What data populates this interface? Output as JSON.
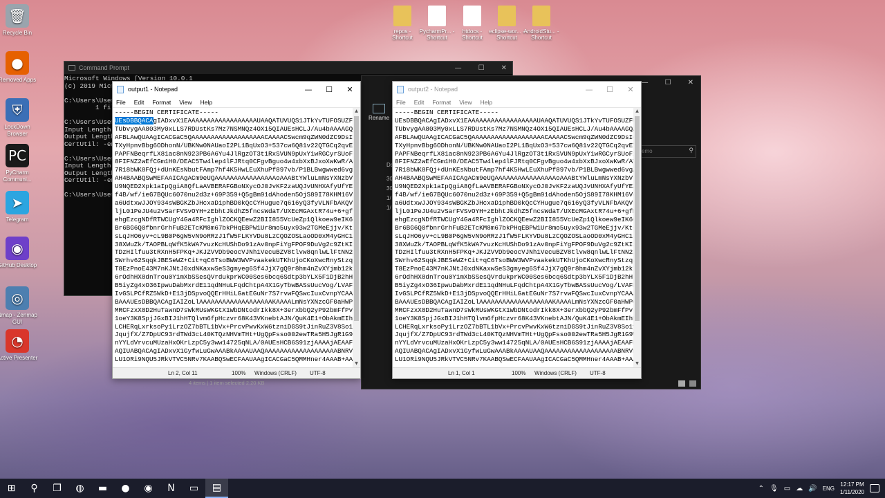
{
  "desktop_left_icons": [
    {
      "label": "Recycle Bin",
      "icon": "recycle-bin-icon",
      "glyph": "🗑",
      "color": "#9aa4ad"
    },
    {
      "label": "Removed Apps",
      "icon": "firefox-icon",
      "glyph": "●",
      "color": "#e66000"
    },
    {
      "label": "LockDown Browser",
      "icon": "lockdown-browser-icon",
      "glyph": "⛨",
      "color": "#3b6fb6"
    },
    {
      "label": "PyCharm Communi...",
      "icon": "pycharm-icon",
      "glyph": "PC",
      "color": "#1a1a1a"
    },
    {
      "label": "Telegram",
      "icon": "telegram-icon",
      "glyph": "➤",
      "color": "#2ca5e0"
    },
    {
      "label": "GitHub Desktop",
      "icon": "github-desktop-icon",
      "glyph": "◉",
      "color": "#6e40c9"
    },
    {
      "label": "Nmap - Zenmap GUI",
      "icon": "nmap-icon",
      "glyph": "◎",
      "color": "#4d7fb0"
    },
    {
      "label": "Active Presenter",
      "icon": "active-presenter-icon",
      "glyph": "◔",
      "color": "#d9362b"
    }
  ],
  "desktop_top_icons": [
    {
      "label": "repos - Shortcut",
      "icon": "folder-shortcut-icon",
      "color": "#e8c25a"
    },
    {
      "label": "PycharmPr... - Shortcut",
      "icon": "excel-shortcut-icon",
      "color": "#ffffff"
    },
    {
      "label": "htdocs - Shortcut",
      "icon": "file-shortcut-icon",
      "color": "#ffffff"
    },
    {
      "label": "eclipse-wor... - Shortcut",
      "icon": "folder-shortcut-icon",
      "color": "#e8c25a"
    },
    {
      "label": "AndroidStu... - Shortcut",
      "icon": "folder-shortcut-icon",
      "color": "#e8c25a"
    }
  ],
  "cmd": {
    "title": "Command Prompt",
    "lines": [
      "Microsoft Windows [Version 10.0.1",
      "(c) 2019 Micr",
      "",
      "C:\\Users\\User",
      "        1 fil",
      "",
      "C:\\Users\\User",
      "Input Length",
      "Output Length",
      "CertUtil: -en",
      "",
      "C:\\Users\\User",
      "Input Length",
      "Output Length",
      "CertUtil: -en",
      "",
      "C:\\Users\\User"
    ]
  },
  "explorer": {
    "rename_label": "Rename",
    "search_placeholder": "emo",
    "col_header": "Da",
    "col_values": [
      "30",
      "30",
      "1/",
      "1/"
    ],
    "status": "4 items  |  1 item selected  2.20 KB"
  },
  "notepad1": {
    "title": "output1 - Notepad",
    "menu": [
      "File",
      "Edit",
      "Format",
      "View",
      "Help"
    ],
    "selected_text": "UEsDBBQACA",
    "first_line_rest": "gIADxvX1EAAAAAAAAAAAAAAAAAAUAAQATUVUQS1JTkYvTUFOSUZFU1Qu",
    "status": {
      "pos": "Ln 2, Col 11",
      "zoom": "100%",
      "eol": "Windows (CRLF)",
      "enc": "UTF-8"
    }
  },
  "notepad2": {
    "title": "output2 - Notepad",
    "menu": [
      "File",
      "Edit",
      "Format",
      "View",
      "Help"
    ],
    "first_line": "UEsDBBQACAgIADxvX1EAAAAAAAAAAAAAAAAAAUAAQATUVUQS1JTkYvTUFOSUZFU1Qu",
    "status": {
      "pos": "Ln 1, Col 1",
      "zoom": "100%",
      "eol": "Windows (CRLF)",
      "enc": "UTF-8"
    }
  },
  "certificate": {
    "header": "-----BEGIN CERTIFICATE-----",
    "lines": [
      "TUbvygAA803My0xLLS7RDUstKs7Mz7NSMNQz4OXi5QIAUEsHCLJ/Au4bAAAAGQAA",
      "AFBLAwQUAAgICACGaC5QAAAAAAAAAAAAAAAAAAACAAAACSwcm9qZWN0dZC9DsIgFIVn",
      "TXyHpnvBbg6ODhonN/UBKNw0NAUaoI2PL1BqUxO3+537cw6Q81v22QTGCq2qvETH",
      "PAPFNBeqrfLX81ac8nN923PB6A6Yu4JlRgzOT3t1RxSVUN9pUxY1wRGCyrSUoFxN",
      "8FIFNZ2wEfCGm1H0/DEAC5Tw4lep4lFJRtq0CFgvBguo4w4xbXxBJxoXwKwR/AY1",
      "7R18bWK8FQj+dUnKEsNbutFAmp7hf4K5HwLEuXhuPf897vb/P1BLBwgwwed6vgAA",
      "AH4BAABQSwMEFAAICAgACm9eUQAAAAAAAAAAAAAAAAoAAABtYWluLmNsYXNzbVJr",
      "U9NQED2Xpk1aIpQgiA8QfLaAVBERAFGBoNXycOJ0JvKF2zaUQJvUNHXAfyUfYEZH",
      "f4B/wf/ieG7BQUc6070nu2d3z+69P359+Q5gBm91dAhoden5OjS89I78KHM16Vdz",
      "a6UdtxwJJOY934sWBGKZbJHcxaDiphBD0kQcCYHugue7q616yQ3fyVLNFbAKQVnW",
      "ljL01PeJU4u2vSarFVSvOYH+zEbhtJkdhZ5fncsWdaT/UXEcMGAxtR74u+6+gfMC",
      "ehgEzcgNDfRTWCUgY4Ga4RFcIghlZOCKQEewZ2BII855VcUeZp1Qlkoew9eIK6Gs",
      "Br6BG6Q0fbnrGrhFuB2ETcKM8m67bkPHqEBPW1Ur8mo5uyx93w2TGMeEjjv/Kt6n",
      "sLqJHO6yv+cL9B0P6gW5vN9oRRzJ1fW5FLKYVDu8LzCQOZOSLaoOD0xM4yGHC1rR",
      "38XWuZk/TAOPBLqWfK5kWA7vuzKcHUShDo91zAv0npFiYgFPOF9DuVg2c9ZtKI3P",
      "TDzHIlfuu3tRXnH5FPKq+JKJZVVDb9eocVJNh1VecuBZV8tlvw8qnlwLlFtNN2zP",
      "SWrhv62SqqkJBESeWZ+Cit+qC6TsoBWW3WVPvaakekUTKhUjoCKoXwcRnyStzq8c",
      "T8EzPnoE43M7nKJNtJ0xdNKaxwSeS3gmyeg6Sf4JjX7gQ9r8hm4nZvXYjmb12k7c",
      "6rOdhHX8dnTrou0Y1mXbSSesQVrdukprWC00Ses6bcq6Sdtp3bYLX5F1DjB2hHsr",
      "B5iyZg4xO36IpwuDabMxrdE11qdNHuLFqdChtpA4X1GyTbwBASsUucVog/LVAFPH",
      "IvGSLPCfRZ5WkD+E13jDSpvoQQErHHiLGatEGuNr7S7rvwFQSwcIuxCvnpYCAAAH",
      "BAAAUEsDBBQACAgIAIZoLlAAAAAAAAAAAAAAAAAAAKAAAALmNsYXNzcGF0aHWPQUsD",
      "MRCFzxX8D2HuTawnD7sWkRUsWKGtX1WbDNtodrIkk8X+3erxbbQ2yP92bmFfPv",
      "1oeY3K8SpjJGxBIJ1hHTQlvm6fpHczvr68K43VKnebtAJN/QuK4E1+ObAkmEIhR",
      "LCHERqLxrksoPy1LrzOZ7bBTL1bVx+PrcvPwvKxW6tzniDGS9tJinRuZ3V8So1yz",
      "JqujfX/Z7DpUC93rdTWd3cL40KTQzNHVmTHt+UgQpFsso002ewTRa5H5JgR1G9W",
      "nYYLdVrvcuMUzaHxOKrLzpC5y3ww14725qNLA/0AUEsHCB6S91zjAAAAjAEAAFBL",
      "AQIUABQACAgIADxvX1GyfwLuGwAAABkAAAAUAAQAAAAAAAAAAAAAAAAAAABNRVRB",
      "LU1ORi9NQU5JRkVTVC5NRv7KAABQSwECFAAUAAgICACGaC5QMMHner4AAAB+AAAA"
    ]
  },
  "taskbar": {
    "icons": [
      {
        "name": "start-button",
        "glyph": "⊞"
      },
      {
        "name": "search-icon",
        "glyph": "⚲"
      },
      {
        "name": "task-view-icon",
        "glyph": "❐"
      },
      {
        "name": "steam-icon",
        "glyph": "◍"
      },
      {
        "name": "file-explorer-icon",
        "glyph": "▬"
      },
      {
        "name": "firefox-icon",
        "glyph": "●"
      },
      {
        "name": "chrome-icon",
        "glyph": "◉"
      },
      {
        "name": "notion-icon",
        "glyph": "N"
      },
      {
        "name": "terminal-icon",
        "glyph": "▭"
      },
      {
        "name": "notepad-icon",
        "glyph": "▤"
      }
    ],
    "language": "ENG",
    "time": "12:17 PM",
    "date": "1/11/2020"
  }
}
